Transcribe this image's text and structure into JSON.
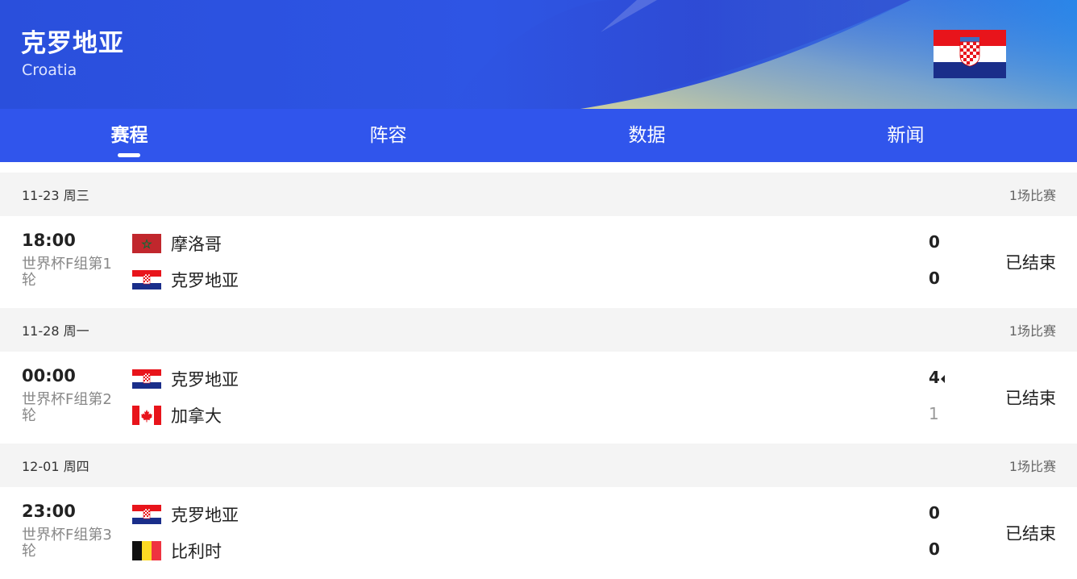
{
  "team": {
    "name_cn": "克罗地亚",
    "name_en": "Croatia"
  },
  "tabs": [
    {
      "label": "赛程",
      "active": true
    },
    {
      "label": "阵容",
      "active": false
    },
    {
      "label": "数据",
      "active": false
    },
    {
      "label": "新闻",
      "active": false
    }
  ],
  "days": [
    {
      "date": "11-23 周三",
      "count": "1场比赛",
      "match": {
        "time": "18:00",
        "competition": "世界杯F组第1轮",
        "home": {
          "name": "摩洛哥",
          "flag": "morocco-flag",
          "score": "0"
        },
        "away": {
          "name": "克罗地亚",
          "flag": "croatia-flag",
          "score": "0"
        },
        "status": "已结束"
      }
    },
    {
      "date": "11-28 周一",
      "count": "1场比赛",
      "match": {
        "time": "00:00",
        "competition": "世界杯F组第2轮",
        "home": {
          "name": "克罗地亚",
          "flag": "croatia-flag",
          "score": "4"
        },
        "away": {
          "name": "加拿大",
          "flag": "canada-flag",
          "score": "1"
        },
        "status": "已结束"
      }
    },
    {
      "date": "12-01 周四",
      "count": "1场比赛",
      "match": {
        "time": "23:00",
        "competition": "世界杯F组第3轮",
        "home": {
          "name": "克罗地亚",
          "flag": "croatia-flag",
          "score": "0"
        },
        "away": {
          "name": "比利时",
          "flag": "belgium-flag",
          "score": "0"
        },
        "status": "已结束"
      }
    }
  ],
  "colors": {
    "header_blue": "#2e55e4",
    "tab_bar": "#3055ec",
    "day_bg": "#f4f4f4"
  }
}
